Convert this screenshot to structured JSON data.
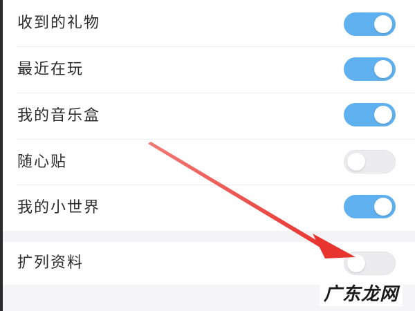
{
  "settings": {
    "items": [
      {
        "label": "收到的礼物",
        "enabled": true
      },
      {
        "label": "最近在玩",
        "enabled": true
      },
      {
        "label": "我的音乐盒",
        "enabled": true
      },
      {
        "label": "随心贴",
        "enabled": false
      },
      {
        "label": "我的小世界",
        "enabled": true
      },
      {
        "label": "扩列资料",
        "enabled": false
      }
    ]
  },
  "colors": {
    "toggle_on": "#5fb0ee",
    "toggle_off": "#ececef",
    "arrow": "#e8342f",
    "text": "#2d2d2d"
  },
  "watermark": {
    "text": "广东龙网"
  }
}
